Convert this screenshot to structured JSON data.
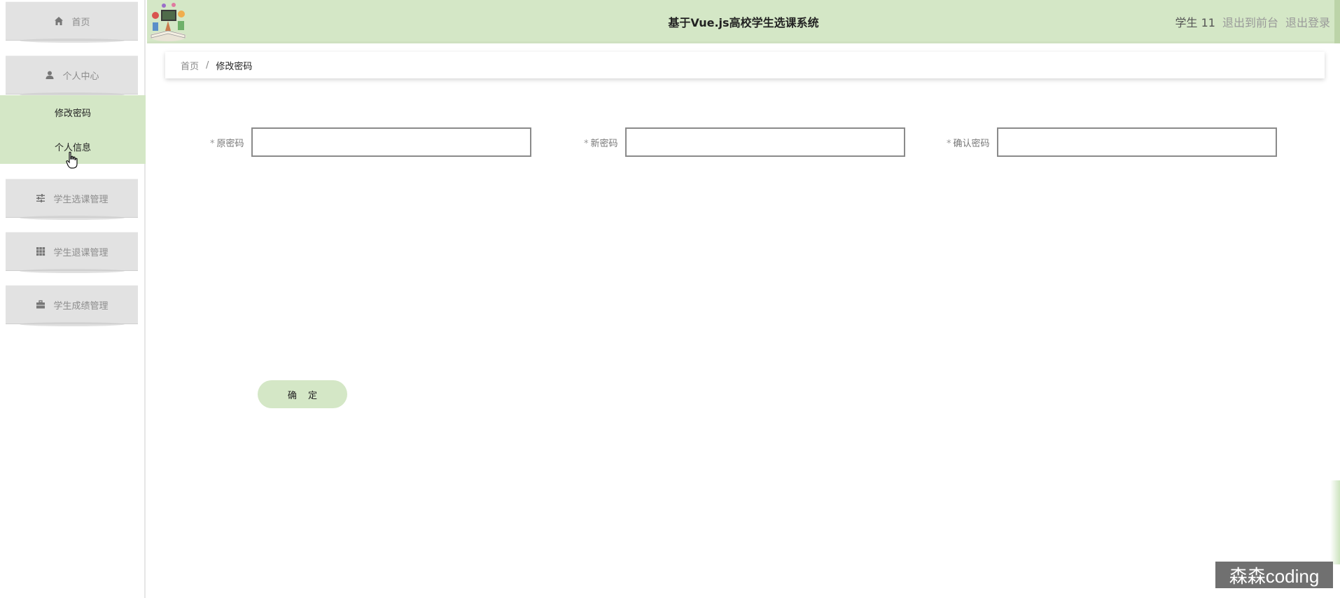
{
  "header": {
    "title": "基于Vue.js高校学生选课系统",
    "user": "学生 11",
    "to_frontend": "退出到前台",
    "logout": "退出登录"
  },
  "sidebar": {
    "home": "首页",
    "personal_center": "个人中心",
    "submenu": [
      "修改密码",
      "个人信息"
    ],
    "course_select": "学生选课管理",
    "course_drop": "学生退课管理",
    "grades": "学生成绩管理"
  },
  "breadcrumb": {
    "home": "首页",
    "separator": "/",
    "current": "修改密码"
  },
  "form": {
    "old_password_label": "原密码",
    "new_password_label": "新密码",
    "confirm_password_label": "确认密码",
    "required_mark": "*",
    "old_password_value": "",
    "new_password_value": "",
    "confirm_password_value": "",
    "submit_label": "确 定"
  },
  "watermark": "森森coding",
  "colors": {
    "accent": "#d4e7c6",
    "menu_bg": "#e2e2e2"
  }
}
